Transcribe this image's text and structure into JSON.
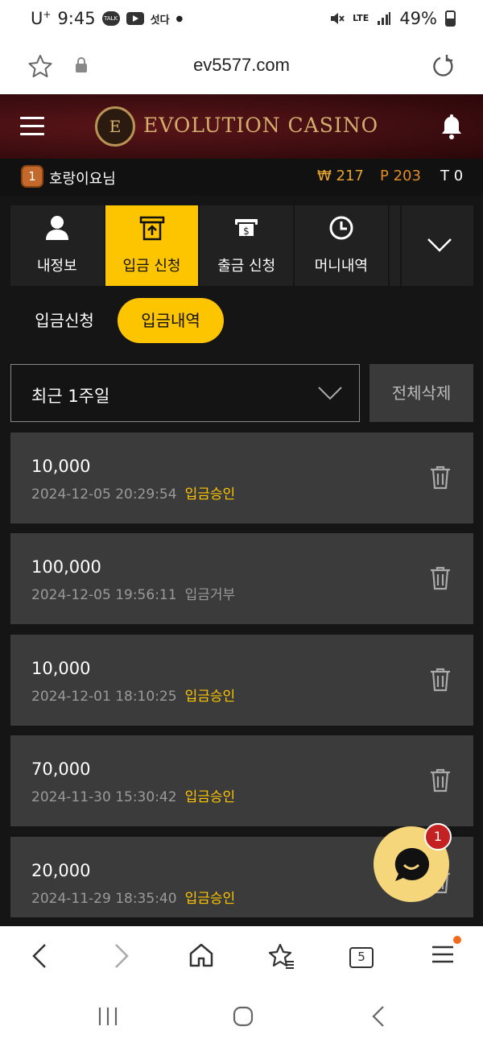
{
  "status_bar": {
    "carrier": "U",
    "carrier_sup": "+",
    "time": "9:45",
    "talk_label": "TALK",
    "app_label": "섯다",
    "network": "LTE",
    "battery": "49%"
  },
  "browser": {
    "url": "ev5577.com",
    "tab_count": "5"
  },
  "header": {
    "logo_letter": "E",
    "logo_text": "EVOLUTION CASINO"
  },
  "user": {
    "level": "1",
    "name": "호랑이요님",
    "won": "₩ 217",
    "points": "P 203",
    "tickets": "T 0"
  },
  "menu": {
    "tabs": [
      {
        "label": "내정보",
        "icon": "user-icon"
      },
      {
        "label": "입금 신청",
        "icon": "deposit-icon",
        "active": true
      },
      {
        "label": "출금 신청",
        "icon": "withdraw-icon"
      },
      {
        "label": "머니내역",
        "icon": "clock-icon"
      }
    ]
  },
  "subtabs": {
    "request": "입금신청",
    "history": "입금내역"
  },
  "filter": {
    "period": "최근 1주일",
    "delete_all": "전체삭제"
  },
  "transactions": [
    {
      "amount": "10,000",
      "datetime": "2024-12-05 20:29:54",
      "status": "입금승인",
      "approved": true
    },
    {
      "amount": "100,000",
      "datetime": "2024-12-05 19:56:11",
      "status": "입금거부",
      "approved": false
    },
    {
      "amount": "10,000",
      "datetime": "2024-12-01 18:10:25",
      "status": "입금승인",
      "approved": true
    },
    {
      "amount": "70,000",
      "datetime": "2024-11-30 15:30:42",
      "status": "입금승인",
      "approved": true
    },
    {
      "amount": "20,000",
      "datetime": "2024-11-29 18:35:40",
      "status": "입금승인",
      "approved": true
    }
  ],
  "chat": {
    "badge": "1"
  },
  "colors": {
    "accent": "#fdc400",
    "header_bg": "#3d0d10",
    "card_bg": "#3b3b3b",
    "status_rejected": "#9a9a9a"
  }
}
